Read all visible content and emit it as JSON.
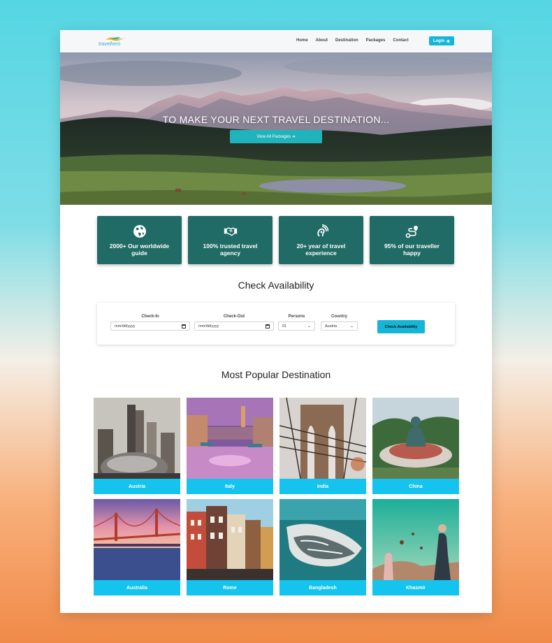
{
  "brand": {
    "logo_text": "travelhero"
  },
  "nav": {
    "links": [
      "Home",
      "About",
      "Destination",
      "Packages",
      "Contact"
    ],
    "login_label": "Login"
  },
  "hero": {
    "title": "TO MAKE YOUR NEXT TRAVEL DESTINATION...",
    "button_label": "View All Packages"
  },
  "features": [
    {
      "icon": "globe-icon",
      "label": "2000+ Our worldwide guide"
    },
    {
      "icon": "handshake-icon",
      "label": "100% trusted travel agency"
    },
    {
      "icon": "sound-signal-icon",
      "label": "20+ year of travel experience"
    },
    {
      "icon": "route-icon",
      "label": "95% of our traveller happy"
    }
  ],
  "availability": {
    "title": "Check Availability",
    "checkin_label": "Check-In",
    "checkin_value": "mm/dd/yyyy",
    "checkout_label": "Check-Out",
    "checkout_value": "mm/dd/yyyy",
    "persons_label": "Persons",
    "persons_value": "01",
    "country_label": "Country",
    "country_value": "Austria",
    "button_label": "Check Availability"
  },
  "destinations": {
    "title": "Most Popular Destination",
    "items": [
      "Austria",
      "Italy",
      "India",
      "China",
      "Australia",
      "Rome",
      "Bangladesh",
      "Khasmir"
    ]
  },
  "colors": {
    "accent": "#14b5d6",
    "feature_bg": "#216b66",
    "dest_label_bg": "#14c3ee"
  }
}
